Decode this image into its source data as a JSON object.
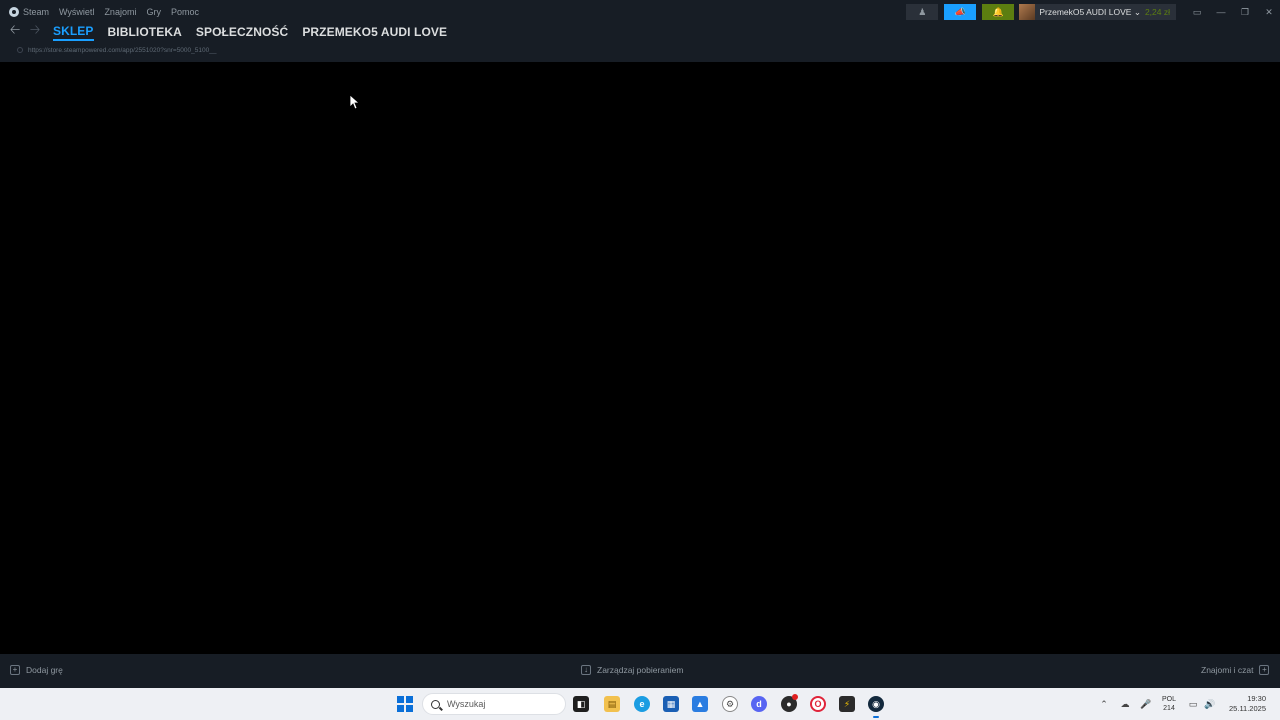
{
  "menubar": {
    "items": [
      "Steam",
      "Wyświetl",
      "Znajomi",
      "Gry",
      "Pomoc"
    ]
  },
  "nav": {
    "tabs": [
      "SKLEP",
      "BIBLIOTEKA",
      "SPOŁECZNOŚĆ",
      "PRZEMEKO5 AUDI LOVE"
    ],
    "active_tab": "SKLEP",
    "url": "https://store.steampowered.com/app/2551020?snr=5000_5100__"
  },
  "account": {
    "name": "PrzemekO5 AUDI LOVE",
    "balance": "2,24 zł"
  },
  "bottombar": {
    "add_game": "Dodaj grę",
    "downloads": "Zarządzaj pobieraniem",
    "friends": "Znajomi i czat"
  },
  "taskbar": {
    "search_placeholder": "Wyszukaj",
    "lang_top": "POL",
    "lang_bottom": "214",
    "time": "19:30",
    "date": "25.11.2025"
  },
  "colors": {
    "steam_bg": "#171d25",
    "accent": "#1a9fff",
    "green": "#5c7e10"
  }
}
